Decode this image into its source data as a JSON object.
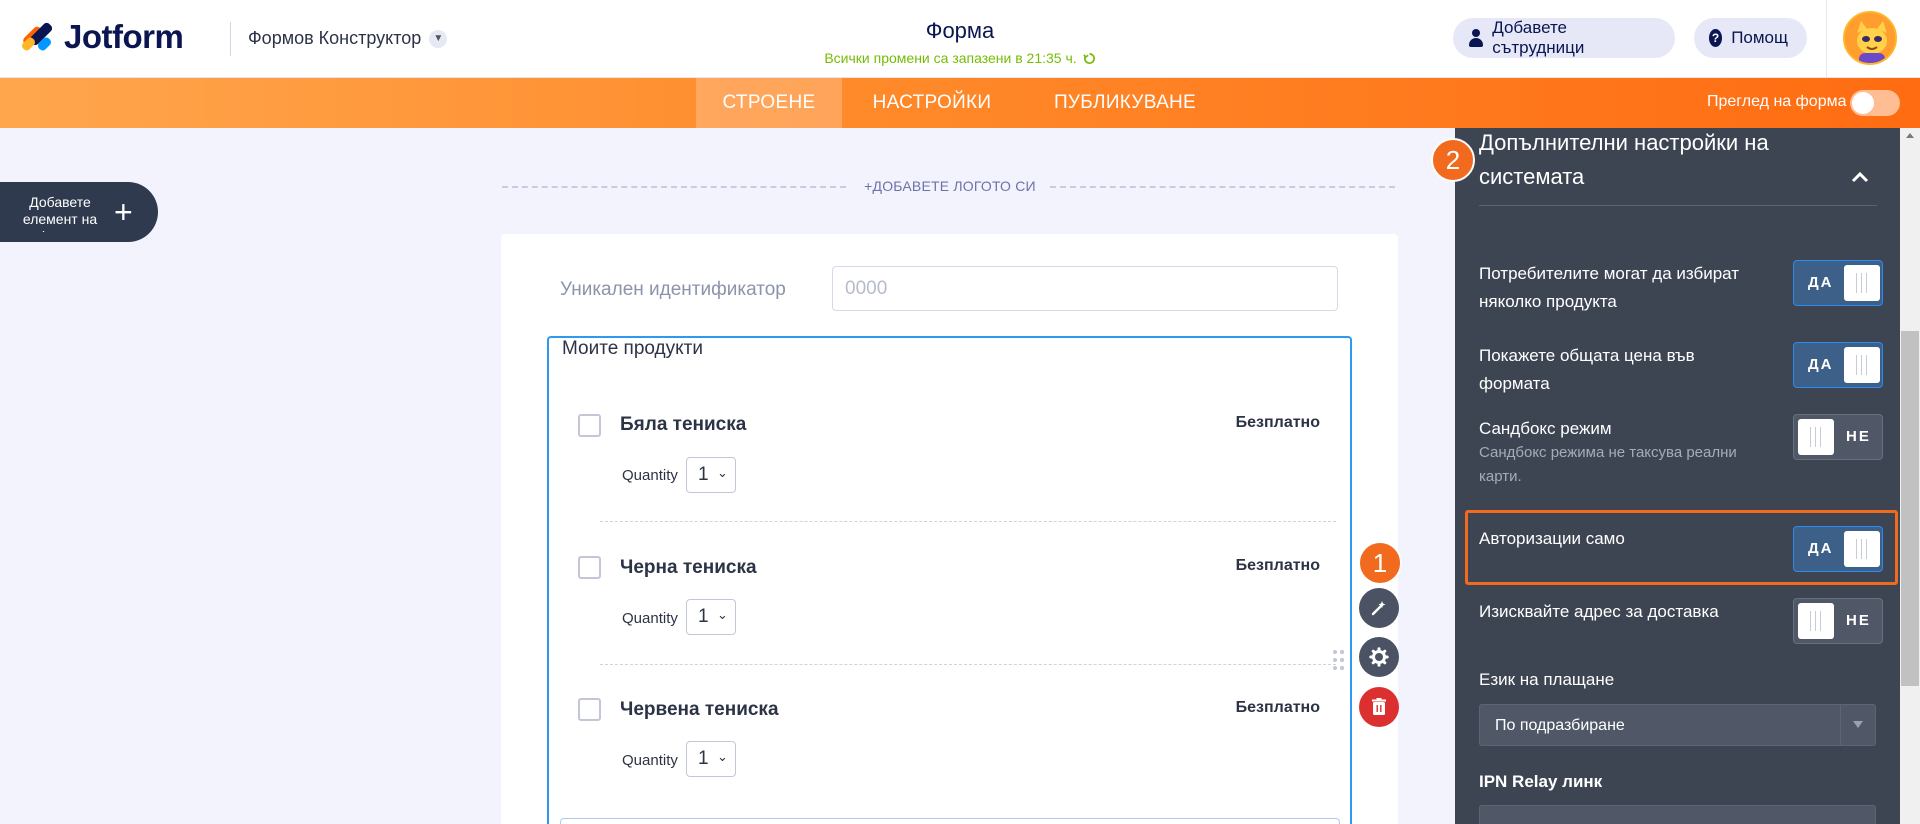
{
  "header": {
    "brand": "Jotform",
    "builder_menu_label": "Формов Конструктор",
    "form_title": "Форма",
    "saved_status": "Всички промени са запазени в 21:35 ч.",
    "add_collaborators_label": "Добавете сътрудници",
    "help_label": "Помощ"
  },
  "tabs": {
    "build": "СТРОЕНЕ",
    "settings": "НАСТРОЙКИ",
    "publish": "ПУБЛИКУВАНЕ",
    "preview_label": "Преглед на форма"
  },
  "left": {
    "add_element_label": "Добавете елемент на форма"
  },
  "form": {
    "add_logo_label": "+ДОБАВЕТЕ ЛОГОТО СИ",
    "unique_id_label": "Уникален идентификатор",
    "unique_id_placeholder": "0000",
    "products_title": "Моите продукти",
    "quantity_label": "Quantity",
    "products": [
      {
        "name": "Бяла тениска",
        "price": "Безплатно",
        "quantity": "1"
      },
      {
        "name": "Черна тениска",
        "price": "Безплатно",
        "quantity": "1"
      },
      {
        "name": "Червена тениска",
        "price": "Безплатно",
        "quantity": "1"
      }
    ]
  },
  "steps": {
    "one": "1",
    "two": "2"
  },
  "panel": {
    "title": "Допълнителни настройки на системата",
    "settings": [
      {
        "label": "Потребителите могат да избират няколко продукта",
        "hint": "",
        "state": "ДА"
      },
      {
        "label": "Покажете общата цена във формата",
        "hint": "",
        "state": "ДА"
      },
      {
        "label": "Сандбокс режим",
        "hint": "Сандбокс режима не таксува реални карти.",
        "state": "НЕ"
      },
      {
        "label": "Авторизации само",
        "hint": "",
        "state": "ДА"
      },
      {
        "label": "Изисквайте адрес за доставка",
        "hint": "",
        "state": "НЕ"
      }
    ],
    "payment_language_label": "Език на плащане",
    "payment_language_value": "По подразбиране",
    "ipn_relay_label": "IPN Relay линк"
  },
  "colors": {
    "accent_orange": "#ff6c12",
    "selection_blue": "#2e99f0",
    "panel_bg": "#3e4552",
    "saved_green": "#78bb07",
    "delete_red": "#dc3030"
  }
}
